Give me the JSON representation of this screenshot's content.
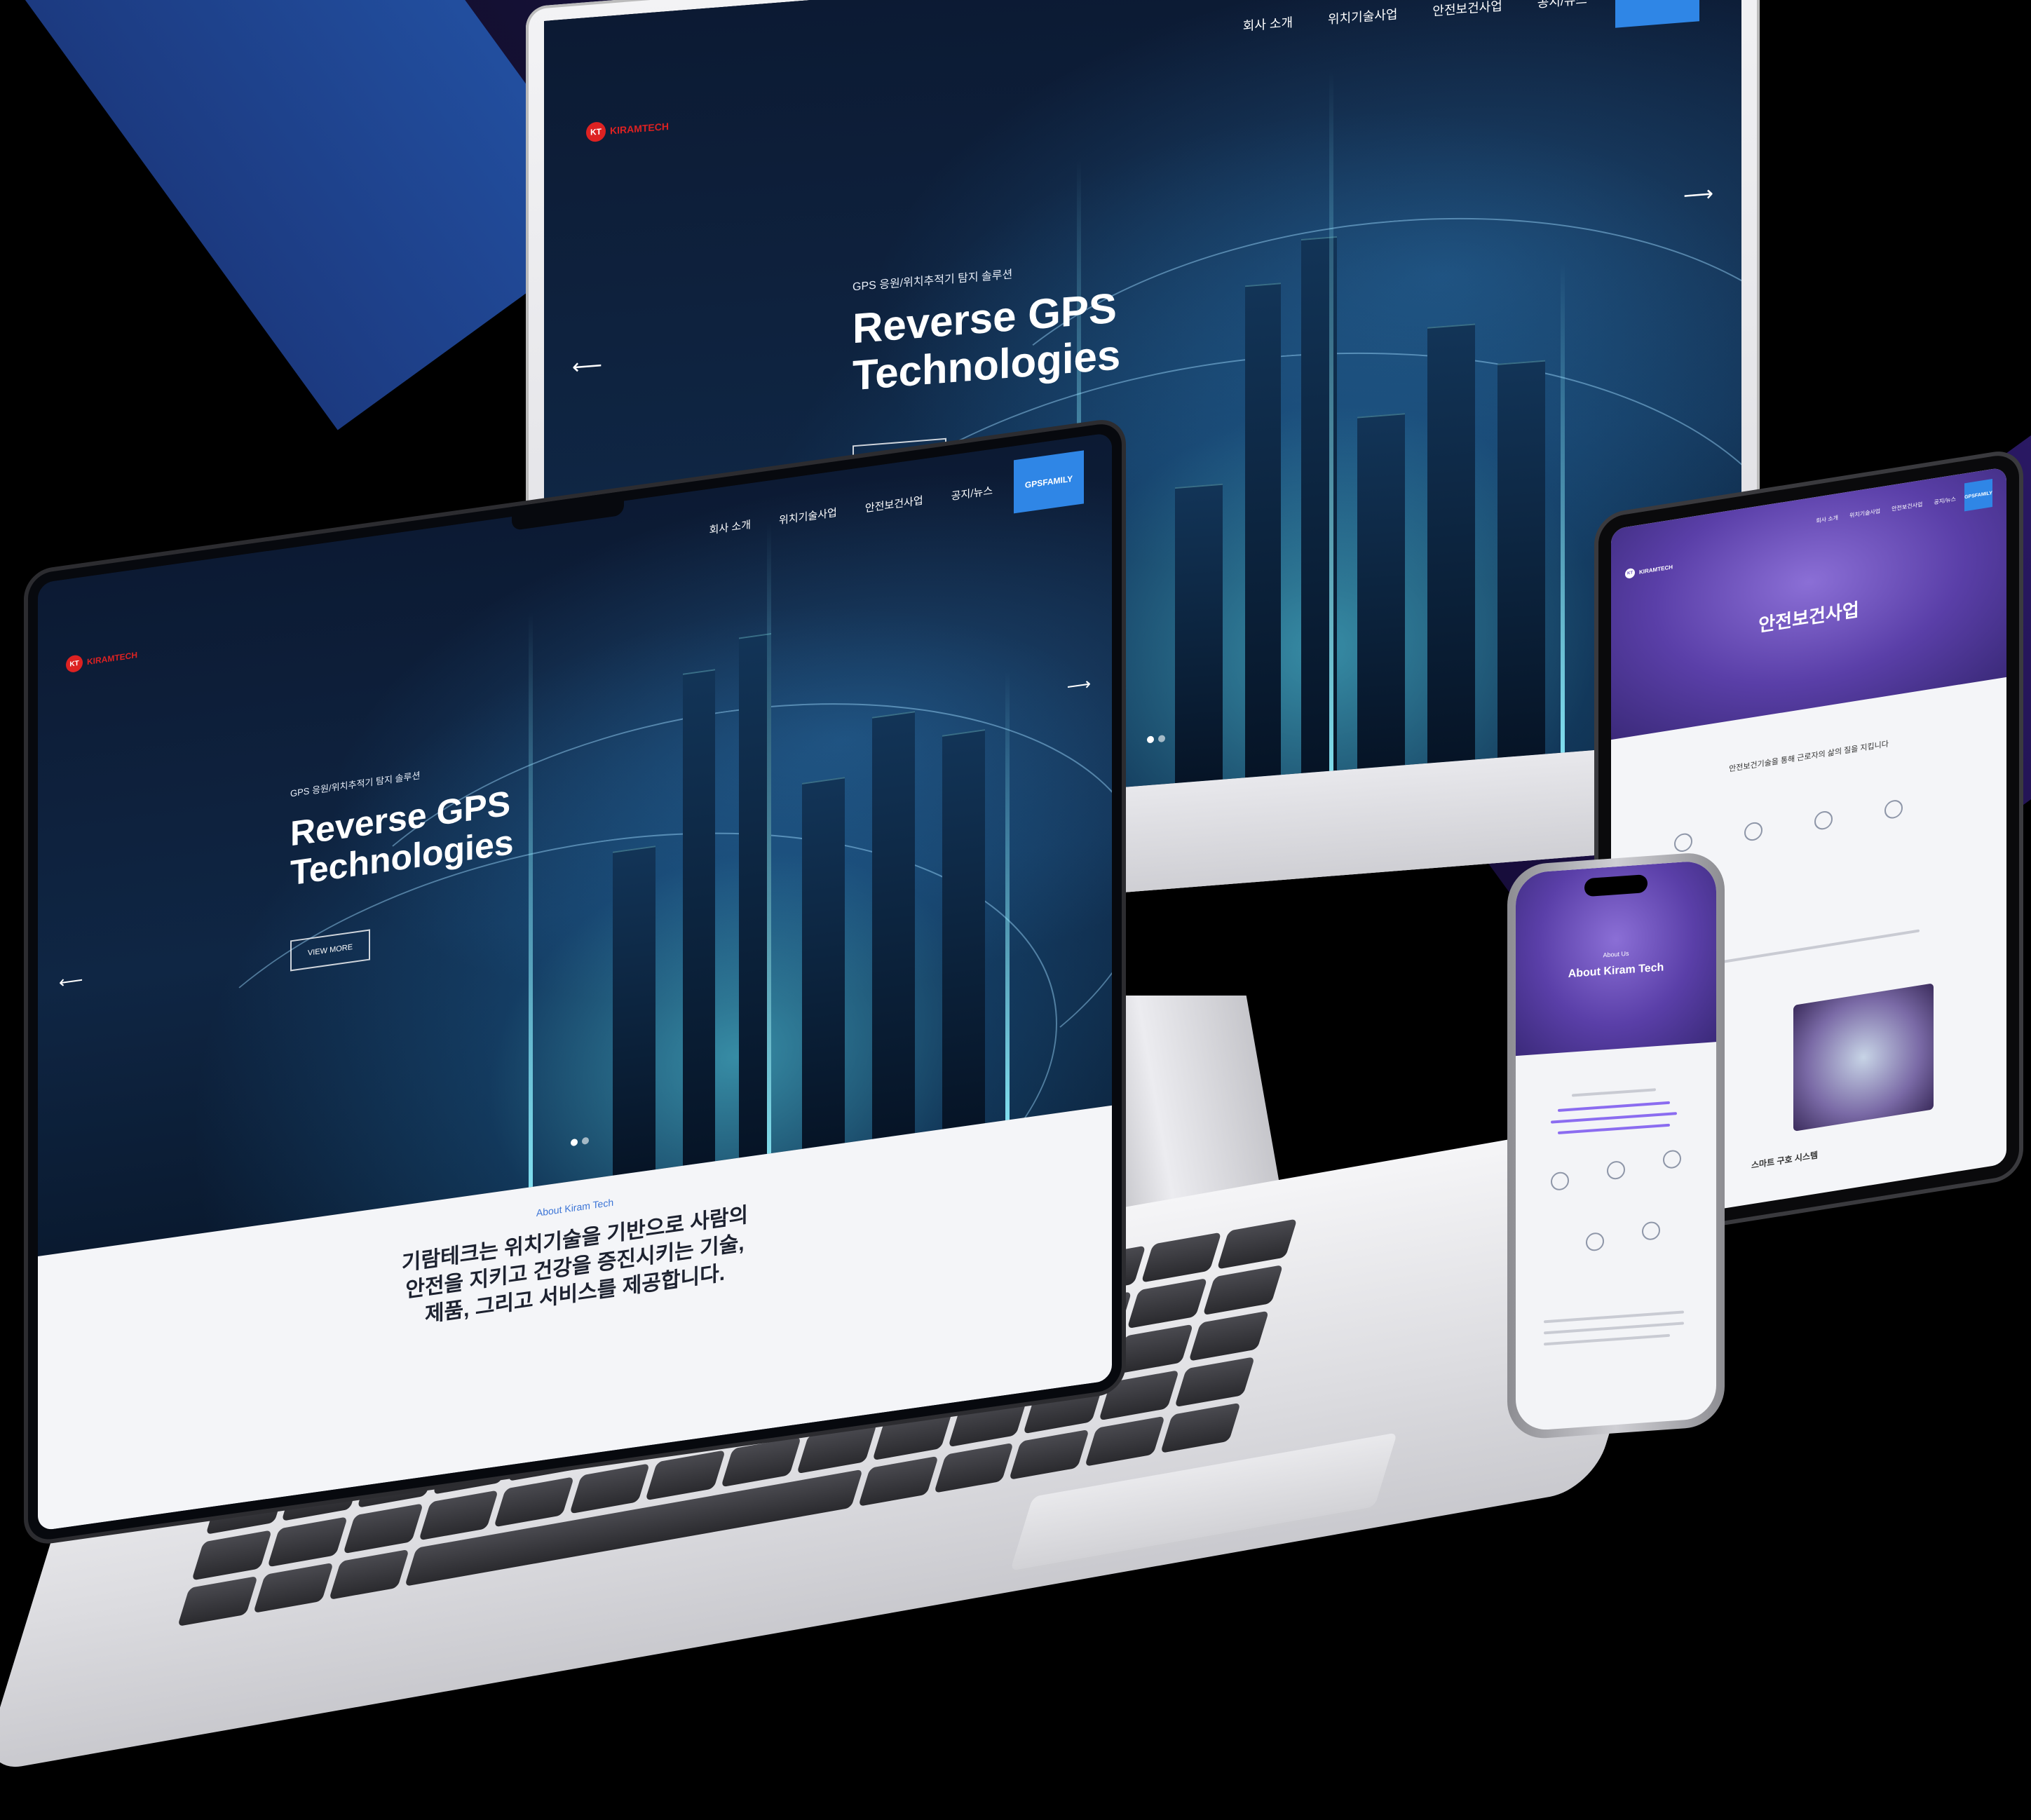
{
  "site": {
    "logo_text": "KIRAMTECH",
    "logo_mark": "KT",
    "nav": [
      "회사 소개",
      "위치기술사업",
      "안전보건사업",
      "공지/뉴스"
    ],
    "nav_cta": "GPSFAMILY",
    "hero_eyebrow": "GPS 응원/위치추적기 탐지 솔루션",
    "hero_title_line1": "Reverse GPS",
    "hero_title_line2": "Technologies",
    "hero_button": "VIEW MORE",
    "prev_arrow": "⟵",
    "next_arrow": "⟶"
  },
  "laptop": {
    "about_label": "About Kiram Tech",
    "about_line1": "기람테크는 위치기술을 기반으로 사람의",
    "about_line2": "안전을 지키고 건강을 증진시키는 기술,",
    "about_line3": "제품, 그리고 서비스를 제공합니다."
  },
  "tablet": {
    "hero_title": "안전보건사업",
    "section_text": "안전보건기술을 통해 근로자의 삶의 질을 지킵니다",
    "footer_text": "스마트 구호 시스템"
  },
  "phone": {
    "hero_small": "About Us",
    "hero_title": "About Kiram Tech"
  },
  "colors": {
    "accent_blue": "#2f86e6",
    "brand_red": "#dd2222",
    "purple": "#6a4fc0"
  }
}
